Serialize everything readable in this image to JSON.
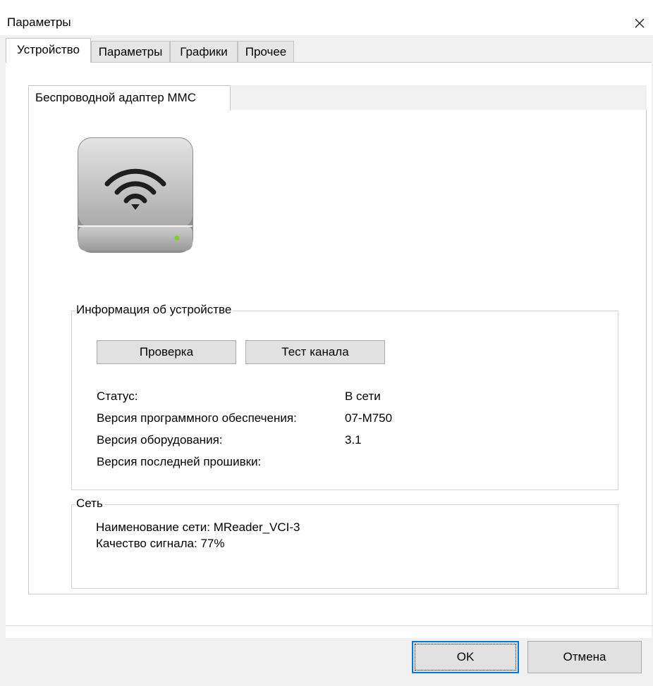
{
  "window": {
    "title": "Параметры"
  },
  "tabs": [
    "Устройство",
    "Параметры",
    "Графики",
    "Прочее"
  ],
  "inner_tab": {
    "label": "Беспроводной адаптер MMC"
  },
  "device_info": {
    "legend": "Информация об устройстве",
    "check_button": "Проверка",
    "channel_test_button": "Тест канала",
    "rows": [
      {
        "label": "Статус:",
        "value": "В сети"
      },
      {
        "label": "Версия программного обеспечения:",
        "value": "07-M750"
      },
      {
        "label": "Версия оборудования:",
        "value": "3.1"
      },
      {
        "label": "Версия последней прошивки:",
        "value": ""
      }
    ]
  },
  "network": {
    "legend": "Сеть",
    "name_line": "Наименование сети: MReader_VCI-3",
    "signal_line": "Качество сигнала: 77%"
  },
  "footer": {
    "ok": "OK",
    "cancel": "Отмена"
  },
  "icons": {
    "close": "close-icon",
    "device": "wireless-adapter-icon",
    "wifi": "wifi-icon"
  },
  "colors": {
    "default_button_border": "#0078d7",
    "status_led": "#7ed321"
  }
}
